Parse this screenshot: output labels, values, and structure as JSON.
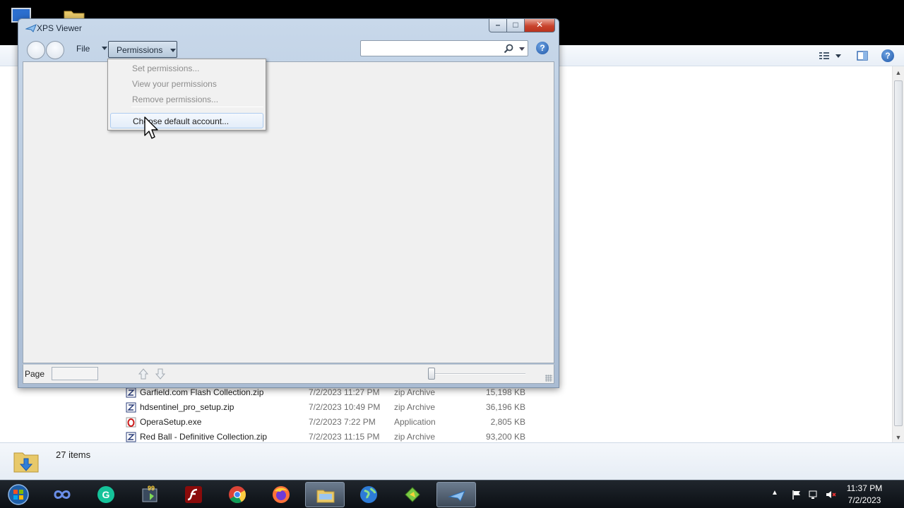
{
  "window": {
    "title": "XPS Viewer",
    "controls": {
      "minimize": "–",
      "maximize": "□",
      "close": "✕"
    }
  },
  "toolbar": {
    "file_label": "File",
    "permissions_label": "Permissions",
    "search_placeholder": "",
    "help_label": "?"
  },
  "permissions_menu": {
    "items": [
      {
        "label": "Set permissions...",
        "enabled": false
      },
      {
        "label": "View your permissions",
        "enabled": false
      },
      {
        "label": "Remove permissions...",
        "enabled": false
      },
      {
        "label": "Choose default account...",
        "enabled": true,
        "hovered": true
      }
    ]
  },
  "statusbar": {
    "page_label": "Page",
    "page_value": ""
  },
  "explorer": {
    "files": [
      {
        "name": "Garfield.com Flash Collection.zip",
        "date": "7/2/2023 11:27 PM",
        "type": "zip Archive",
        "size": "15,198 KB",
        "icon": "zip-icon"
      },
      {
        "name": "hdsentinel_pro_setup.zip",
        "date": "7/2/2023 10:49 PM",
        "type": "zip Archive",
        "size": "36,196 KB",
        "icon": "zip-icon"
      },
      {
        "name": "OperaSetup.exe",
        "date": "7/2/2023 7:22 PM",
        "type": "Application",
        "size": "2,805 KB",
        "icon": "opera-icon"
      },
      {
        "name": "Red Ball - Definitive Collection.zip",
        "date": "7/2/2023 11:15 PM",
        "type": "zip Archive",
        "size": "93,200 KB",
        "icon": "zip-icon"
      }
    ],
    "item_count": "27 items"
  },
  "taskbar": {
    "apps": [
      "start-orb-icon",
      "infinity-app-icon",
      "grammarly-icon",
      "app-99-icon",
      "flash-icon",
      "chrome-icon",
      "firefox-icon",
      "file-explorer-icon",
      "globe-icon",
      "app-diamond-icon",
      "xps-viewer-icon"
    ],
    "clock_time": "11:37 PM",
    "clock_date": "7/2/2023"
  },
  "colors": {
    "accent": "#1d56a8",
    "window_frame": "#b4c6dc",
    "close_button": "#c8432d",
    "taskbar": "#0b0f14"
  }
}
